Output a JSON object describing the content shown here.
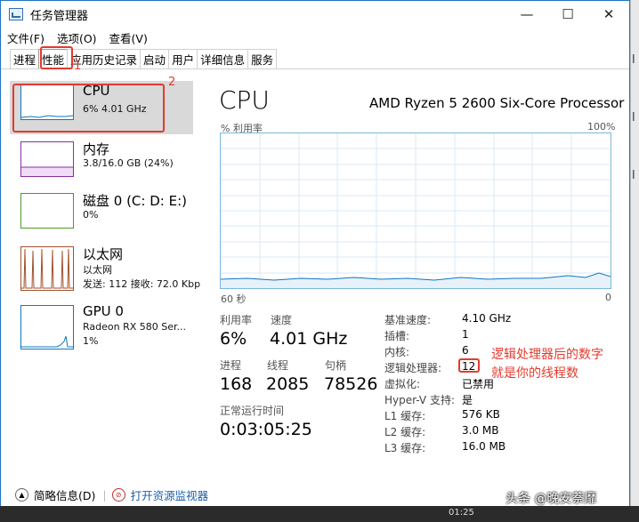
{
  "window": {
    "title": "任务管理器",
    "controls": {
      "minimize": "—",
      "maximize": "☐",
      "close": "✕"
    }
  },
  "menu": [
    "文件(F)",
    "选项(O)",
    "查看(V)"
  ],
  "tabs": [
    "进程",
    "性能",
    "应用历史记录",
    "启动",
    "用户",
    "详细信息",
    "服务"
  ],
  "annotations": {
    "tab_number": "1",
    "item_number": "2",
    "note_line1": "逻辑处理器后的数字",
    "note_line2": "就是你的线程数"
  },
  "sidebar": [
    {
      "name": "CPU",
      "sub1": "6%  4.01 GHz",
      "sub2": ""
    },
    {
      "name": "内存",
      "sub1": "3.8/16.0 GB (24%)",
      "sub2": ""
    },
    {
      "name": "磁盘 0 (C: D: E:)",
      "sub1": "0%",
      "sub2": ""
    },
    {
      "name": "以太网",
      "sub1": "以太网",
      "sub2": "发送: 112 接收: 72.0 Kbp"
    },
    {
      "name": "GPU 0",
      "sub1": "Radeon RX 580 Ser...",
      "sub2": "1%"
    }
  ],
  "detail": {
    "title": "CPU",
    "processor": "AMD Ryzen 5 2600 Six-Core Processor",
    "graph_label": "% 利用率",
    "graph_max": "100%",
    "graph_time": "60 秒",
    "graph_min": "0",
    "utilization_label": "利用率",
    "utilization": "6%",
    "speed_label": "速度",
    "speed": "4.01 GHz",
    "processes_label": "进程",
    "processes": "168",
    "threads_label": "线程",
    "threads": "2085",
    "handles_label": "句柄",
    "handles": "78526",
    "uptime_label": "正常运行时间",
    "uptime": "0:03:05:25",
    "info": [
      {
        "label": "基准速度:",
        "value": "4.10 GHz"
      },
      {
        "label": "插槽:",
        "value": "1"
      },
      {
        "label": "内核:",
        "value": "6"
      },
      {
        "label": "逻辑处理器:",
        "value": "12"
      },
      {
        "label": "虚拟化:",
        "value": "已禁用"
      },
      {
        "label": "Hyper-V 支持:",
        "value": "是"
      },
      {
        "label": "L1 缓存:",
        "value": "576 KB"
      },
      {
        "label": "L2 缓存:",
        "value": "3.0 MB"
      },
      {
        "label": "L3 缓存:",
        "value": "16.0 MB"
      }
    ]
  },
  "footer": {
    "brief": "简略信息(D)",
    "monitor": "打开资源监视器"
  },
  "taskbar_text": "01:25",
  "watermark": "头条 @晚安萘靡",
  "colors": {
    "cpu": "#1177bb",
    "memory": "#8b2fa0",
    "disk": "#4c9a2a",
    "ethernet": "#a0522d",
    "gpu": "#1177bb",
    "highlight": "#e23b2e"
  }
}
